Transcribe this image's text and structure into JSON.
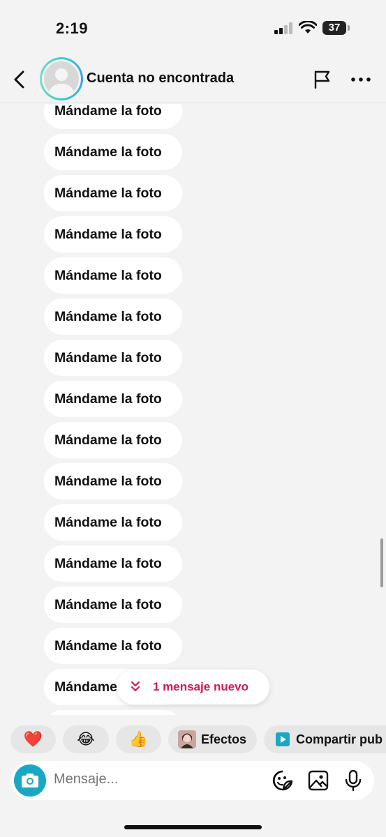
{
  "status_bar": {
    "time": "2:19",
    "battery": "37",
    "icons": [
      "signal-icon",
      "wifi-icon",
      "battery-icon"
    ]
  },
  "header": {
    "title": "Cuenta no encontrada",
    "icons": [
      "back-chevron-icon",
      "avatar-placeholder-icon",
      "flag-icon",
      "more-dots-icon"
    ]
  },
  "messages": [
    {
      "text": "Mándame la foto"
    },
    {
      "text": "Mándame la foto"
    },
    {
      "text": "Mándame la foto"
    },
    {
      "text": "Mándame la foto"
    },
    {
      "text": "Mándame la foto"
    },
    {
      "text": "Mándame la foto"
    },
    {
      "text": "Mándame la foto"
    },
    {
      "text": "Mándame la foto"
    },
    {
      "text": "Mándame la foto"
    },
    {
      "text": "Mándame la foto"
    },
    {
      "text": "Mándame la foto"
    },
    {
      "text": "Mándame la foto"
    },
    {
      "text": "Mándame la foto"
    },
    {
      "text": "Mándame la foto"
    },
    {
      "text": "Mándame la foto"
    },
    {
      "text": ""
    }
  ],
  "new_message_pill": {
    "label": "1 mensaje nuevo",
    "icon": "double-chevron-down-icon",
    "color": "#d4145a"
  },
  "quick_reactions": [
    {
      "emoji": "❤️",
      "name": "heart"
    },
    {
      "emoji": "😂",
      "name": "laugh"
    },
    {
      "emoji": "👍",
      "name": "thumbs-up"
    }
  ],
  "effects_chip": {
    "label": "Efectos"
  },
  "share_chip": {
    "label": "Compartir pub"
  },
  "composer": {
    "placeholder": "Mensaje...",
    "icons": [
      "camera-icon",
      "sticker-icon",
      "gallery-icon",
      "microphone-icon"
    ]
  },
  "colors": {
    "background": "#f3f3f3",
    "bubble": "#ffffff",
    "accent_teal": "#1aa7c4",
    "alert_pink": "#d4145a"
  }
}
